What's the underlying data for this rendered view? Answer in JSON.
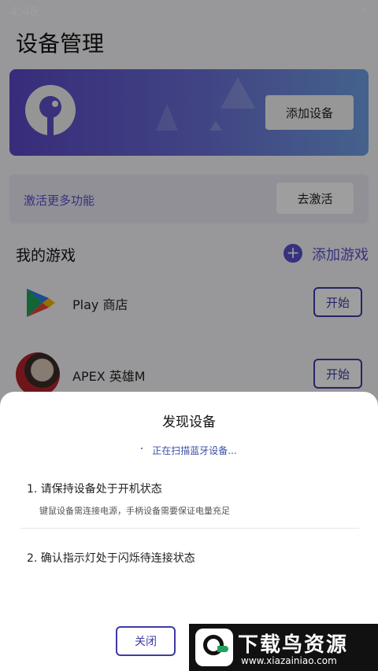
{
  "status_bar": {
    "time": "4:46",
    "charging_icon": "bolt-icon"
  },
  "page": {
    "title": "设备管理"
  },
  "banner": {
    "add_device_label": "添加设备",
    "logo_icon": "app-logo-icon"
  },
  "activate": {
    "text": "激活更多功能",
    "button_label": "去激活"
  },
  "games_section": {
    "title": "我的游戏",
    "add_game_label": "添加游戏",
    "add_icon": "plus-circle-icon"
  },
  "games": [
    {
      "name": "Play 商店",
      "start_label": "开始",
      "icon": "play-store-icon"
    },
    {
      "name": "APEX 英雄M",
      "start_label": "开始",
      "icon": "apex-avatar-icon"
    }
  ],
  "dialog": {
    "title": "发现设备",
    "scan_status": "正在扫描蓝牙设备...",
    "step1_title": "1. 请保持设备处于开机状态",
    "step1_desc": "键鼠设备需连接电源，手柄设备需要保证电量充足",
    "step2_title": "2. 确认指示灯处于闪烁待连接状态",
    "close_label": "关闭"
  },
  "watermark": {
    "text": "下载鸟资源",
    "url": "www.xiazainiao.com"
  },
  "colors": {
    "accent": "#5a4fcf",
    "button_border": "#3d3aa6",
    "banner_start": "#5a48c6",
    "banner_end": "#6f9ee2"
  }
}
